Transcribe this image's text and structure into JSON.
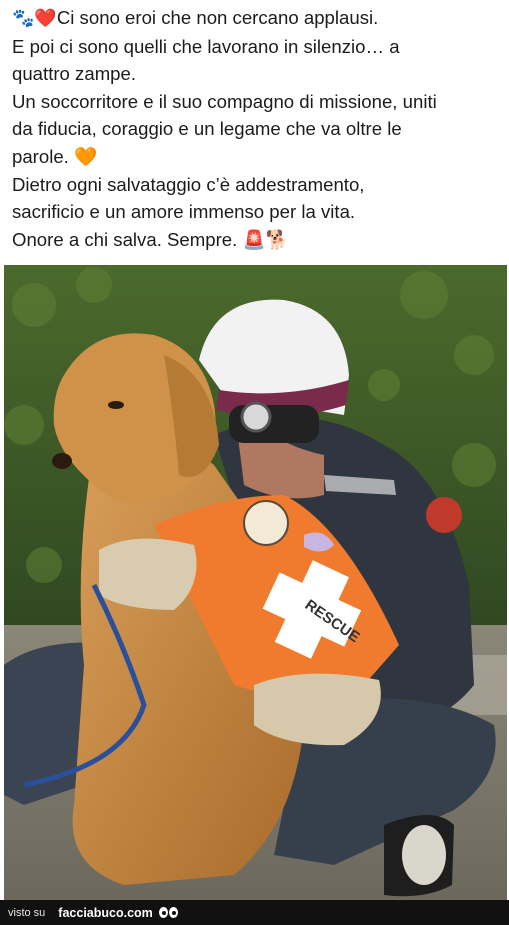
{
  "caption": {
    "lines": [
      {
        "prefix": "🐾❤️",
        "text": "Ci sono eroi che non cercano applausi."
      },
      {
        "prefix": "",
        "text": "E poi ci sono quelli che lavorano in silenzio… a"
      },
      {
        "prefix": "",
        "text": "quattro zampe."
      },
      {
        "prefix": "",
        "text": "Un soccorritore e il suo compagno di missione, uniti"
      },
      {
        "prefix": "",
        "text": "da fiducia, coraggio e un legame che va oltre le"
      },
      {
        "prefix": "",
        "text": "parole. 🧡"
      },
      {
        "prefix": "",
        "text": "Dietro ogni salvataggio c’è addestramento,"
      },
      {
        "prefix": "",
        "text": "sacrificio e un amore immenso per la vita."
      },
      {
        "prefix": "",
        "text": "Onore a chi salva. Sempre. 🚨🐕"
      }
    ]
  },
  "photo": {
    "vest_text": "RESCUE",
    "colors": {
      "hedge": "#3f5a28",
      "dog_fur": "#c98a3e",
      "vest": "#f07a2e",
      "helmet": "#f2f2f2"
    }
  },
  "footer": {
    "visto_label": "visto su",
    "site_label": "facciabuco.com"
  }
}
